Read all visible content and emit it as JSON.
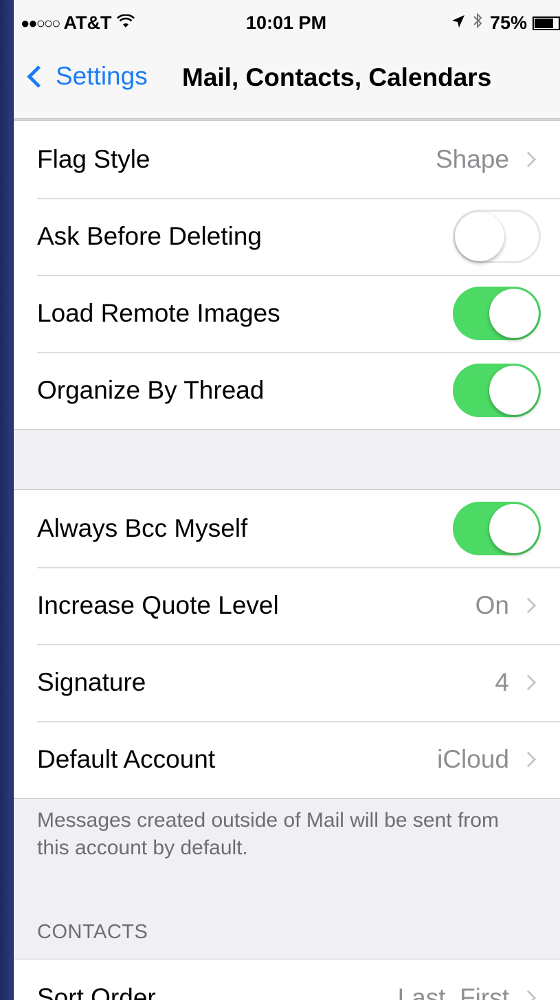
{
  "status_bar": {
    "signal": "●●○○○",
    "carrier": "AT&T",
    "wifi": "wifi-icon",
    "time": "10:01 PM",
    "location": "location-arrow-icon",
    "bluetooth": "bluetooth-icon",
    "battery_percent": "75%",
    "battery_level": 0.75
  },
  "nav": {
    "back_label": "Settings",
    "title": "Mail, Contacts, Calendars"
  },
  "group1": {
    "rows": [
      {
        "label": "Flag Style",
        "value": "Shape"
      },
      {
        "label": "Ask Before Deleting",
        "toggle": false
      },
      {
        "label": "Load Remote Images",
        "toggle": true
      },
      {
        "label": "Organize By Thread",
        "toggle": true
      }
    ]
  },
  "group2": {
    "rows": [
      {
        "label": "Always Bcc Myself",
        "toggle": true
      },
      {
        "label": "Increase Quote Level",
        "value": "On"
      },
      {
        "label": "Signature",
        "value": "4"
      },
      {
        "label": "Default Account",
        "value": "iCloud"
      }
    ],
    "footer": "Messages created outside of Mail will be sent from this account by default."
  },
  "contacts": {
    "header": "CONTACTS",
    "rows": [
      {
        "label": "Sort Order",
        "value": "Last, First"
      }
    ]
  },
  "colors": {
    "accent": "#1a7cf5",
    "toggle_on": "#4cd964",
    "background": "#efeff4"
  }
}
